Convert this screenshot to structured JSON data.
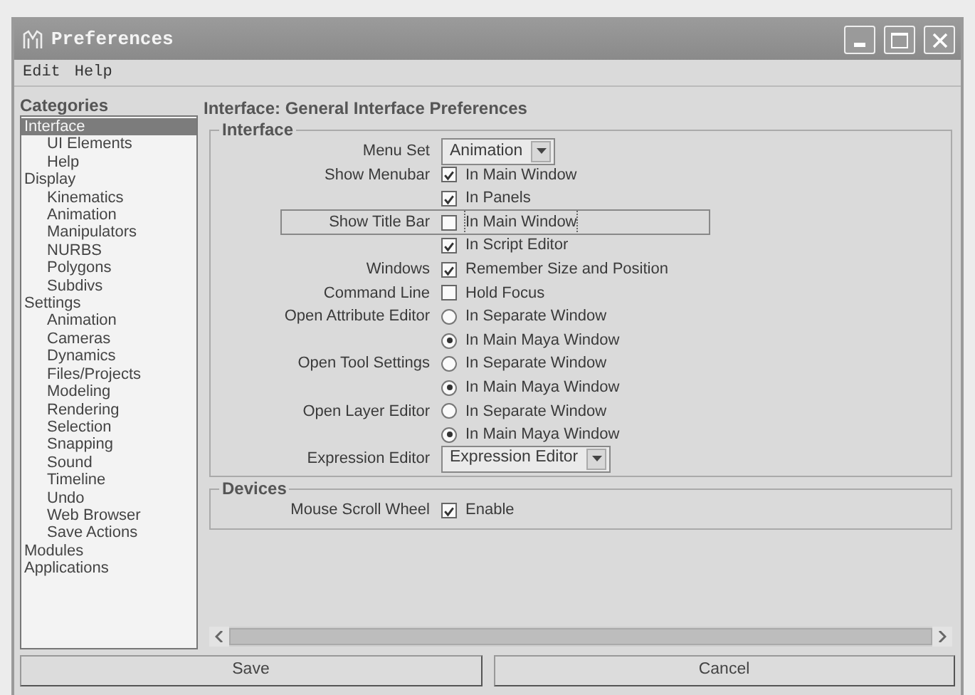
{
  "window": {
    "title": "Preferences"
  },
  "menu": [
    "Edit",
    "Help"
  ],
  "categories": {
    "title": "Categories",
    "items": [
      {
        "label": "Interface",
        "selected": true,
        "children": [
          {
            "label": "UI Elements",
            "selected": false
          },
          {
            "label": "Help",
            "selected": false
          }
        ]
      },
      {
        "label": "Display",
        "selected": false,
        "children": [
          {
            "label": "Kinematics",
            "selected": false
          },
          {
            "label": "Animation",
            "selected": false
          },
          {
            "label": "Manipulators",
            "selected": false
          },
          {
            "label": "NURBS",
            "selected": false
          },
          {
            "label": "Polygons",
            "selected": false
          },
          {
            "label": "Subdivs",
            "selected": false
          }
        ]
      },
      {
        "label": "Settings",
        "selected": false,
        "children": [
          {
            "label": "Animation",
            "selected": false
          },
          {
            "label": "Cameras",
            "selected": false
          },
          {
            "label": "Dynamics",
            "selected": false
          },
          {
            "label": "Files/Projects",
            "selected": false
          },
          {
            "label": "Modeling",
            "selected": false
          },
          {
            "label": "Rendering",
            "selected": false
          },
          {
            "label": "Selection",
            "selected": false
          },
          {
            "label": "Snapping",
            "selected": false
          },
          {
            "label": "Sound",
            "selected": false
          },
          {
            "label": "Timeline",
            "selected": false
          },
          {
            "label": "Undo",
            "selected": false
          },
          {
            "label": "Web Browser",
            "selected": false
          },
          {
            "label": "Save Actions",
            "selected": false
          }
        ]
      },
      {
        "label": "Modules",
        "selected": false
      },
      {
        "label": "Applications",
        "selected": false
      }
    ]
  },
  "panel": {
    "title": "Interface: General Interface Preferences",
    "sections": [
      {
        "title": "Interface",
        "rows": [
          {
            "label": "Menu Set",
            "kind": "dropdown",
            "value": "Animation",
            "focused": false
          },
          {
            "label": "Show Menubar",
            "kind": "checkbox",
            "text": "In Main Window",
            "checked": true,
            "focused": false
          },
          {
            "kind": "checkbox",
            "text": "In Panels",
            "checked": true,
            "focused": false
          },
          {
            "label": "Show Title Bar",
            "kind": "checkbox",
            "text": "In Main Window",
            "checked": false,
            "focused": true
          },
          {
            "kind": "checkbox",
            "text": "In Script Editor",
            "checked": true,
            "focused": false
          },
          {
            "label": "Windows",
            "kind": "checkbox",
            "text": "Remember Size and Position",
            "checked": true,
            "focused": false
          },
          {
            "label": "Command Line",
            "kind": "checkbox",
            "text": "Hold Focus",
            "checked": false,
            "focused": false
          },
          {
            "label": "Open Attribute Editor",
            "kind": "radio",
            "text": "In Separate Window",
            "checked": false,
            "focused": false
          },
          {
            "kind": "radio",
            "text": "In Main Maya Window",
            "checked": true,
            "focused": false
          },
          {
            "label": "Open Tool Settings",
            "kind": "radio",
            "text": "In Separate Window",
            "checked": false,
            "focused": false
          },
          {
            "kind": "radio",
            "text": "In Main Maya Window",
            "checked": true,
            "focused": false
          },
          {
            "label": "Open Layer Editor",
            "kind": "radio",
            "text": "In Separate Window",
            "checked": false,
            "focused": false
          },
          {
            "kind": "radio",
            "text": "In Main Maya Window",
            "checked": true,
            "focused": false
          },
          {
            "label": "Expression Editor",
            "kind": "dropdown",
            "value": "Expression Editor",
            "focused": false
          }
        ]
      },
      {
        "title": "Devices",
        "rows": [
          {
            "label": "Mouse Scroll Wheel",
            "kind": "checkbox",
            "text": "Enable",
            "checked": true,
            "focused": false
          }
        ]
      }
    ]
  },
  "buttons": [
    "Save",
    "Cancel"
  ]
}
